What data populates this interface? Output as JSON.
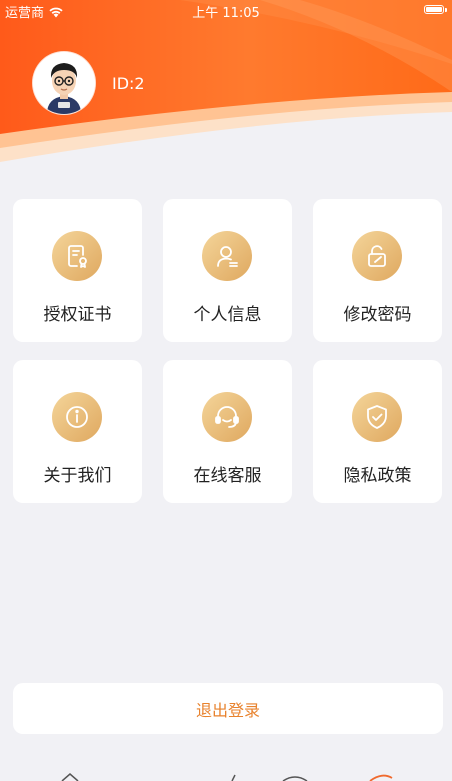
{
  "status_bar": {
    "carrier": "运营商",
    "time": "上午 11:05"
  },
  "profile": {
    "user_id": "ID:2"
  },
  "colors": {
    "header_orange": "#ff6a1f",
    "header_light": "#ffb27a",
    "icon_gold": "#e8b46c",
    "logout_text": "#e8822d",
    "page_bg": "#f1f1f5"
  },
  "menu": [
    {
      "label": "授权证书",
      "icon": "certificate-icon"
    },
    {
      "label": "个人信息",
      "icon": "user-icon"
    },
    {
      "label": "修改密码",
      "icon": "lock-icon"
    },
    {
      "label": "关于我们",
      "icon": "info-icon"
    },
    {
      "label": "在线客服",
      "icon": "headset-icon"
    },
    {
      "label": "隐私政策",
      "icon": "shield-icon"
    }
  ],
  "logout": {
    "label": "退出登录"
  }
}
